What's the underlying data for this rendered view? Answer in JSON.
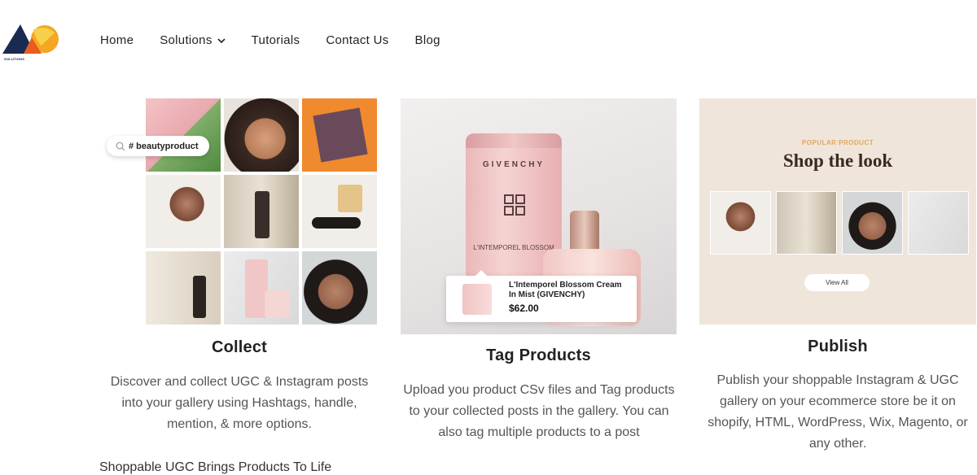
{
  "nav": {
    "items": [
      {
        "label": "Home"
      },
      {
        "label": "Solutions"
      },
      {
        "label": "Tutorials"
      },
      {
        "label": "Contact Us"
      },
      {
        "label": "Blog"
      }
    ]
  },
  "logo": {
    "tiny_text": "SOLUTIONS"
  },
  "collect": {
    "search_tag": "# beautyproduct",
    "title": "Collect",
    "description": "Discover and collect UGC & Instagram posts into your gallery using Hashtags, handle, mention, & more options."
  },
  "tag": {
    "brand": "GIVENCHY",
    "tube_text": "L'INTEMPOREL BLOSSOM",
    "product_name": "L'Intemporel Blossom Cream In Mist (GIVENCHY)",
    "price": "$62.00",
    "title": "Tag Products",
    "description": "Upload you product CSv files and Tag products to your collected posts in the gallery. You can also tag multiple products to a post"
  },
  "publish": {
    "kicker": "POPULAR PRODUCT",
    "heading": "Shop the look",
    "button": "View All",
    "title": "Publish",
    "description": "Publish your shoppable Instagram & UGC gallery on your ecommerce store be it on shopify, HTML, WordPress, Wix, Magento, or any other."
  },
  "cutoff_text": "Shoppable UGC Brings Products To Life",
  "colors": {
    "accent_orange": "#f0a81e",
    "logo_navy": "#1a2b52"
  }
}
